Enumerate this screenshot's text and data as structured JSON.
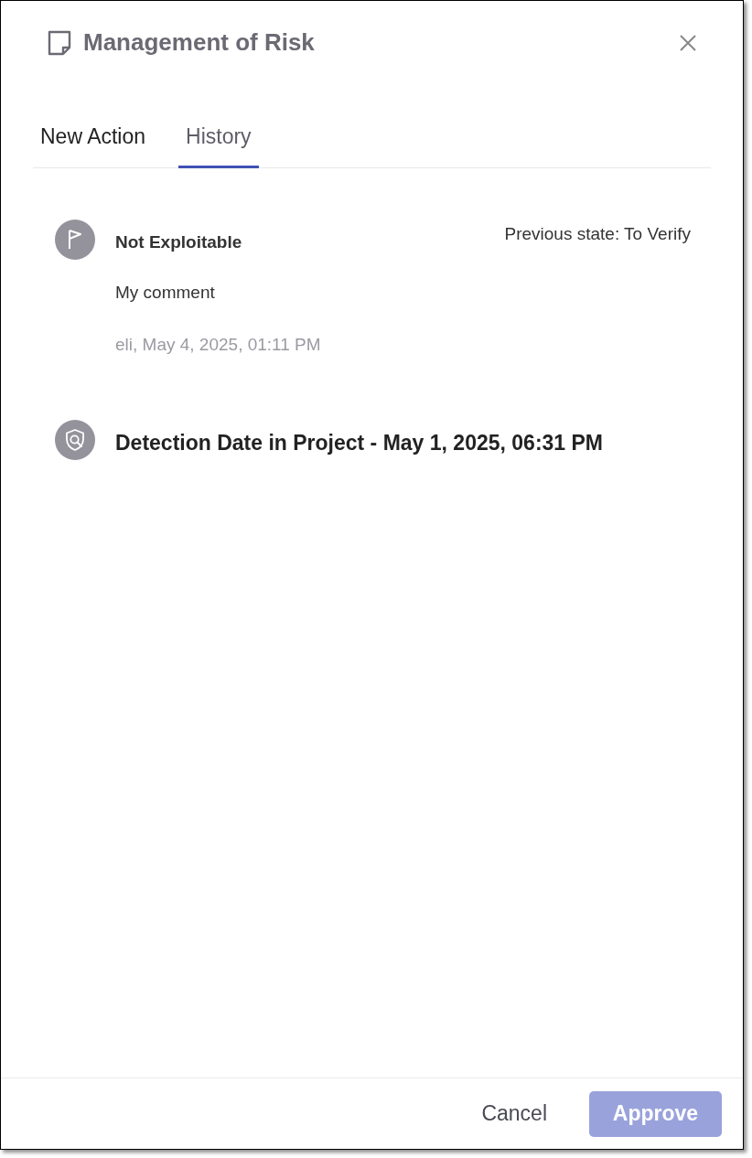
{
  "dialog": {
    "title": "Management of Risk"
  },
  "tabs": [
    {
      "label": "New Action",
      "selected": false
    },
    {
      "label": "History",
      "selected": true
    }
  ],
  "history": [
    {
      "kind": "state_change",
      "title": "Not Exploitable",
      "previous": "Previous state: To Verify",
      "comment": "My comment",
      "meta": "eli, May 4, 2025, 01:11 PM"
    },
    {
      "kind": "detection",
      "title": "Detection Date in Project - May 1, 2025, 06:31 PM"
    }
  ],
  "footer": {
    "cancel": "Cancel",
    "approve": {
      "label": "Approve",
      "disabled": true
    }
  }
}
